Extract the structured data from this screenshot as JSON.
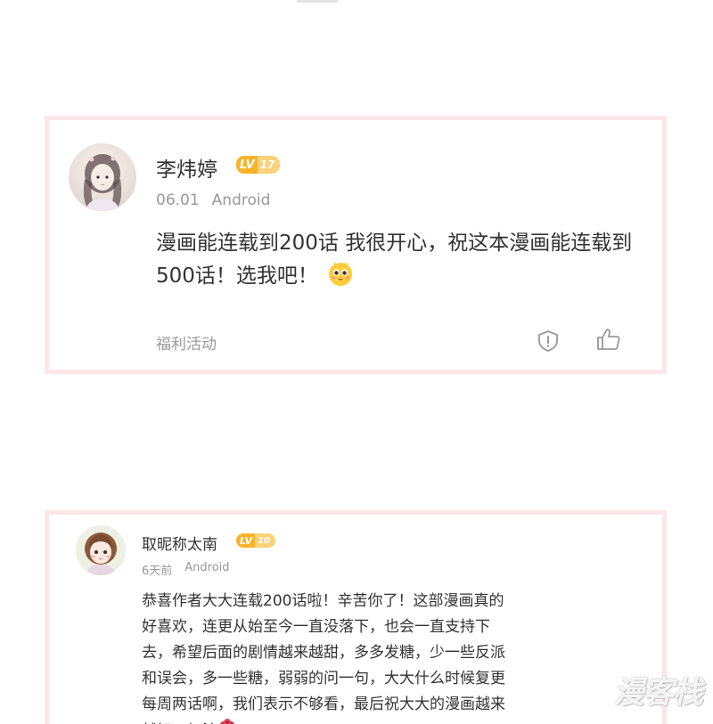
{
  "comments": [
    {
      "username": "李炜婷",
      "level_prefix": "LV",
      "level": "17",
      "date": "06.01",
      "device": "Android",
      "text": "漫画能连载到200话 我很开心，祝这本漫画能连载到500话！选我吧！",
      "emoji": "smiling-face-emoji",
      "tag": "福利活动",
      "actions": [
        "report-icon",
        "like-icon"
      ]
    },
    {
      "username": "取昵称太南",
      "level_prefix": "LV",
      "level": "10",
      "date": "6天前",
      "device": "Android",
      "text": "恭喜作者大大连载200话啦！辛苦你了！这部漫画真的好喜欢，连更从始至今一直没落下，也会一直支持下去，希望后面的剧情越来越甜，多多发糖，少一些反派和误会，多一些糖，弱弱的问一句，大大什么时候复更每周两话啊，我们表示不够看，最后祝大大的漫画越来越好，加油",
      "emoji": "bouquet-emoji"
    }
  ],
  "watermark": "漫客栈",
  "colors": {
    "card_border": "#fbe6e9",
    "level_badge": "#f6b42a",
    "meta_text": "#999999",
    "body_text": "#333333"
  }
}
